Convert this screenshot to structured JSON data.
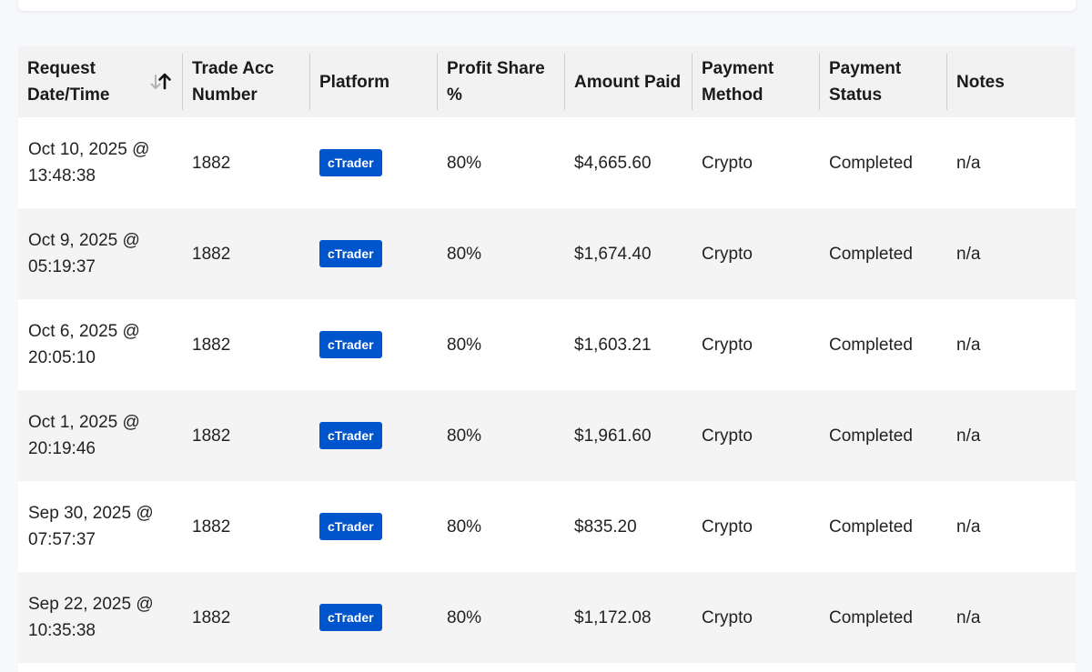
{
  "table": {
    "headers": [
      {
        "line1": "Request",
        "line2": "Date/Time"
      },
      {
        "line1": "Trade Acc",
        "line2": "Number"
      },
      {
        "line1": "Platform",
        "line2": ""
      },
      {
        "line1": "Profit Share",
        "line2": "%"
      },
      {
        "line1": "Amount Paid",
        "line2": ""
      },
      {
        "line1": "Payment",
        "line2": "Method"
      },
      {
        "line1": "Payment",
        "line2": "Status"
      },
      {
        "line1": "Notes",
        "line2": ""
      }
    ],
    "sort": {
      "column": "Request Date/Time",
      "direction": "ascending",
      "icon": "sort-arrows-icon"
    },
    "rows": [
      {
        "date": "Oct 10, 2025 @",
        "time": "13:48:38",
        "account": "1882",
        "platform": "cTrader",
        "profit_share": "80%",
        "amount": "$4,665.60",
        "method": "Crypto",
        "status": "Completed",
        "notes": "n/a"
      },
      {
        "date": "Oct 9, 2025 @",
        "time": "05:19:37",
        "account": "1882",
        "platform": "cTrader",
        "profit_share": "80%",
        "amount": "$1,674.40",
        "method": "Crypto",
        "status": "Completed",
        "notes": "n/a"
      },
      {
        "date": "Oct 6, 2025 @",
        "time": "20:05:10",
        "account": "1882",
        "platform": "cTrader",
        "profit_share": "80%",
        "amount": "$1,603.21",
        "method": "Crypto",
        "status": "Completed",
        "notes": "n/a"
      },
      {
        "date": "Oct 1, 2025 @",
        "time": "20:19:46",
        "account": "1882",
        "platform": "cTrader",
        "profit_share": "80%",
        "amount": "$1,961.60",
        "method": "Crypto",
        "status": "Completed",
        "notes": "n/a"
      },
      {
        "date": "Sep 30, 2025 @",
        "time": "07:57:37",
        "account": "1882",
        "platform": "cTrader",
        "profit_share": "80%",
        "amount": "$835.20",
        "method": "Crypto",
        "status": "Completed",
        "notes": "n/a"
      },
      {
        "date": "Sep 22, 2025 @",
        "time": "10:35:38",
        "account": "1882",
        "platform": "cTrader",
        "profit_share": "80%",
        "amount": "$1,172.08",
        "method": "Crypto",
        "status": "Completed",
        "notes": "n/a"
      }
    ]
  },
  "colors": {
    "badge_bg": "#0055cc",
    "header_bg": "#f2f2f2",
    "row_alt_bg": "#f4f4f4",
    "page_bg": "#f7f8fb"
  }
}
